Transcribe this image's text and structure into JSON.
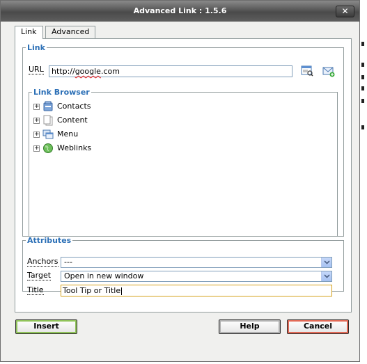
{
  "window": {
    "title": "Advanced Link : 1.5.6",
    "close_label": "✕"
  },
  "tabs": [
    {
      "label": "Link",
      "active": true
    },
    {
      "label": "Advanced",
      "active": false
    }
  ],
  "link_section": {
    "legend": "Link",
    "url_label": "URL",
    "url_value_prefix": "http://",
    "url_value_misspelled": "google",
    "url_value_suffix": ".com"
  },
  "link_browser": {
    "legend": "Link Browser",
    "items": [
      {
        "label": "Contacts",
        "icon": "contacts-icon"
      },
      {
        "label": "Content",
        "icon": "document-icon"
      },
      {
        "label": "Menu",
        "icon": "menu-icon"
      },
      {
        "label": "Weblinks",
        "icon": "globe-icon"
      }
    ]
  },
  "attributes": {
    "legend": "Attributes",
    "anchors_label": "Anchors",
    "anchors_value": "---",
    "target_label": "Target",
    "target_value": "Open in new window",
    "title_label": "Title",
    "title_value": "Tool Tip or Title"
  },
  "buttons": {
    "insert": "Insert",
    "help": "Help",
    "cancel": "Cancel"
  },
  "colors": {
    "legend": "#2b6fb6",
    "insert_border": "#90c35a",
    "cancel_border": "#e26a57",
    "title_focus_border": "#d4a017"
  }
}
